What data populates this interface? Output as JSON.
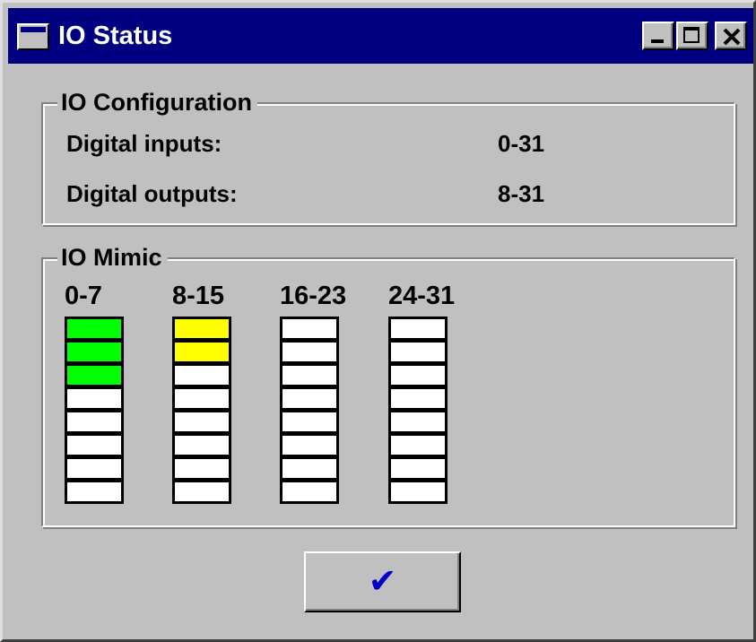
{
  "window": {
    "title": "IO Status",
    "title_icon": "window-icon",
    "controls": [
      "minimize-icon",
      "maximize-icon",
      "close-icon"
    ]
  },
  "io_configuration": {
    "legend": "IO Configuration",
    "rows": [
      {
        "label": "Digital inputs:",
        "value": "0-31"
      },
      {
        "label": "Digital outputs:",
        "value": "8-31"
      }
    ]
  },
  "io_mimic": {
    "legend": "IO Mimic",
    "colors": {
      "on_input": "#00ff00",
      "on_output": "#ffff00",
      "off": "#ffffff",
      "border": "#000000"
    },
    "columns": [
      {
        "label": "0-7",
        "states": [
          "green",
          "green",
          "green",
          "off",
          "off",
          "off",
          "off",
          "off"
        ]
      },
      {
        "label": "8-15",
        "states": [
          "yellow",
          "yellow",
          "off",
          "off",
          "off",
          "off",
          "off",
          "off"
        ]
      },
      {
        "label": "16-23",
        "states": [
          "off",
          "off",
          "off",
          "off",
          "off",
          "off",
          "off",
          "off"
        ]
      },
      {
        "label": "24-31",
        "states": [
          "off",
          "off",
          "off",
          "off",
          "off",
          "off",
          "off",
          "off"
        ]
      }
    ]
  },
  "ok_button": {
    "icon": "checkmark-icon",
    "glyph": "✔"
  }
}
